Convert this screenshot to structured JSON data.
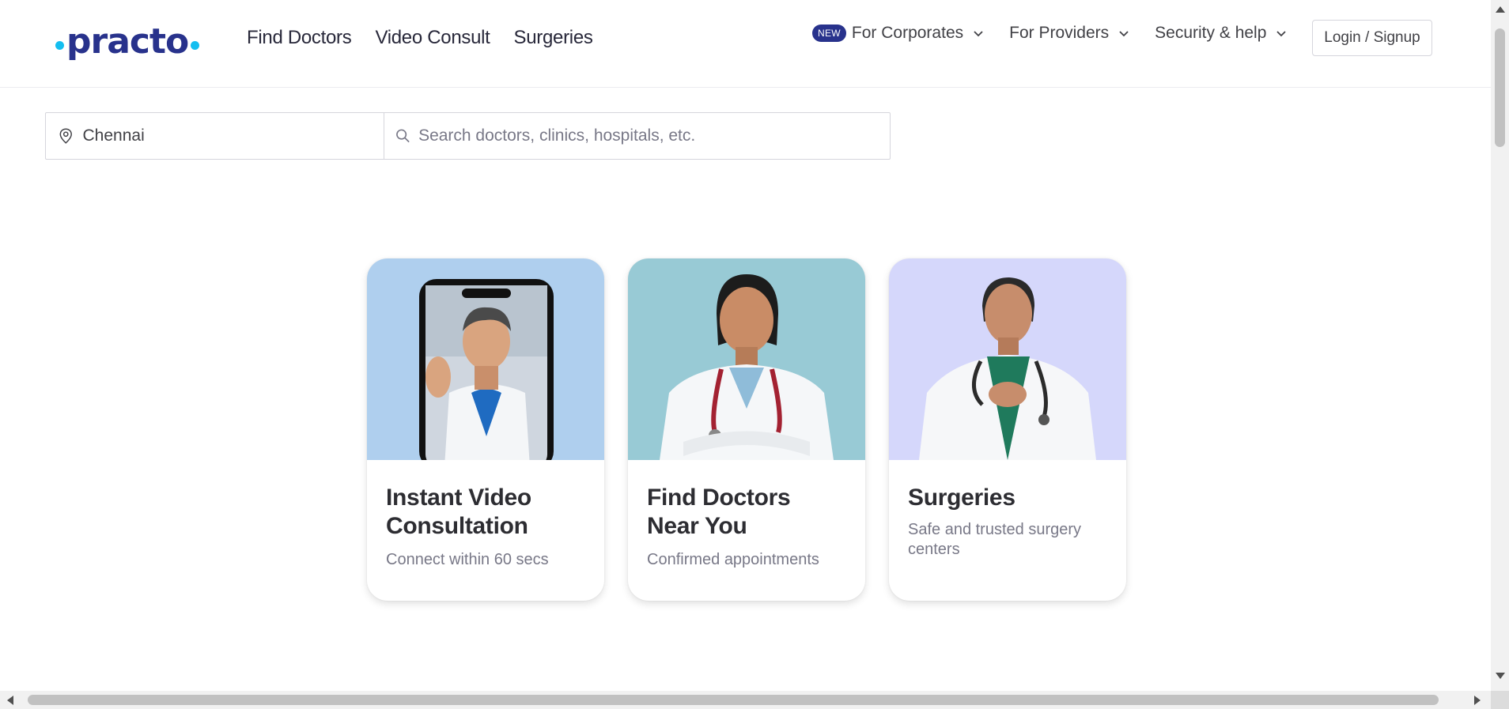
{
  "brand": {
    "logo_text": "practo",
    "accent": "#14bef0",
    "primary": "#28328c"
  },
  "nav": {
    "main": [
      "Find Doctors",
      "Video Consult",
      "Surgeries"
    ],
    "badge": "NEW",
    "corporates": "For Corporates",
    "providers": "For Providers",
    "security": "Security & help",
    "login": "Login / Signup"
  },
  "search": {
    "location_value": "Chennai",
    "query_placeholder": "Search doctors, clinics, hospitals, etc."
  },
  "cards": [
    {
      "title": "Instant Video Consultation",
      "subtitle": "Connect within 60 secs",
      "bg": "#afcfee",
      "icon": "doctor-on-phone"
    },
    {
      "title": "Find Doctors Near You",
      "subtitle": "Confirmed appointments",
      "bg": "#98cad5",
      "icon": "doctor-portrait"
    },
    {
      "title": "Surgeries",
      "subtitle": "Safe and trusted surgery centers",
      "bg": "#d5d7fb",
      "icon": "surgeon-portrait"
    }
  ]
}
